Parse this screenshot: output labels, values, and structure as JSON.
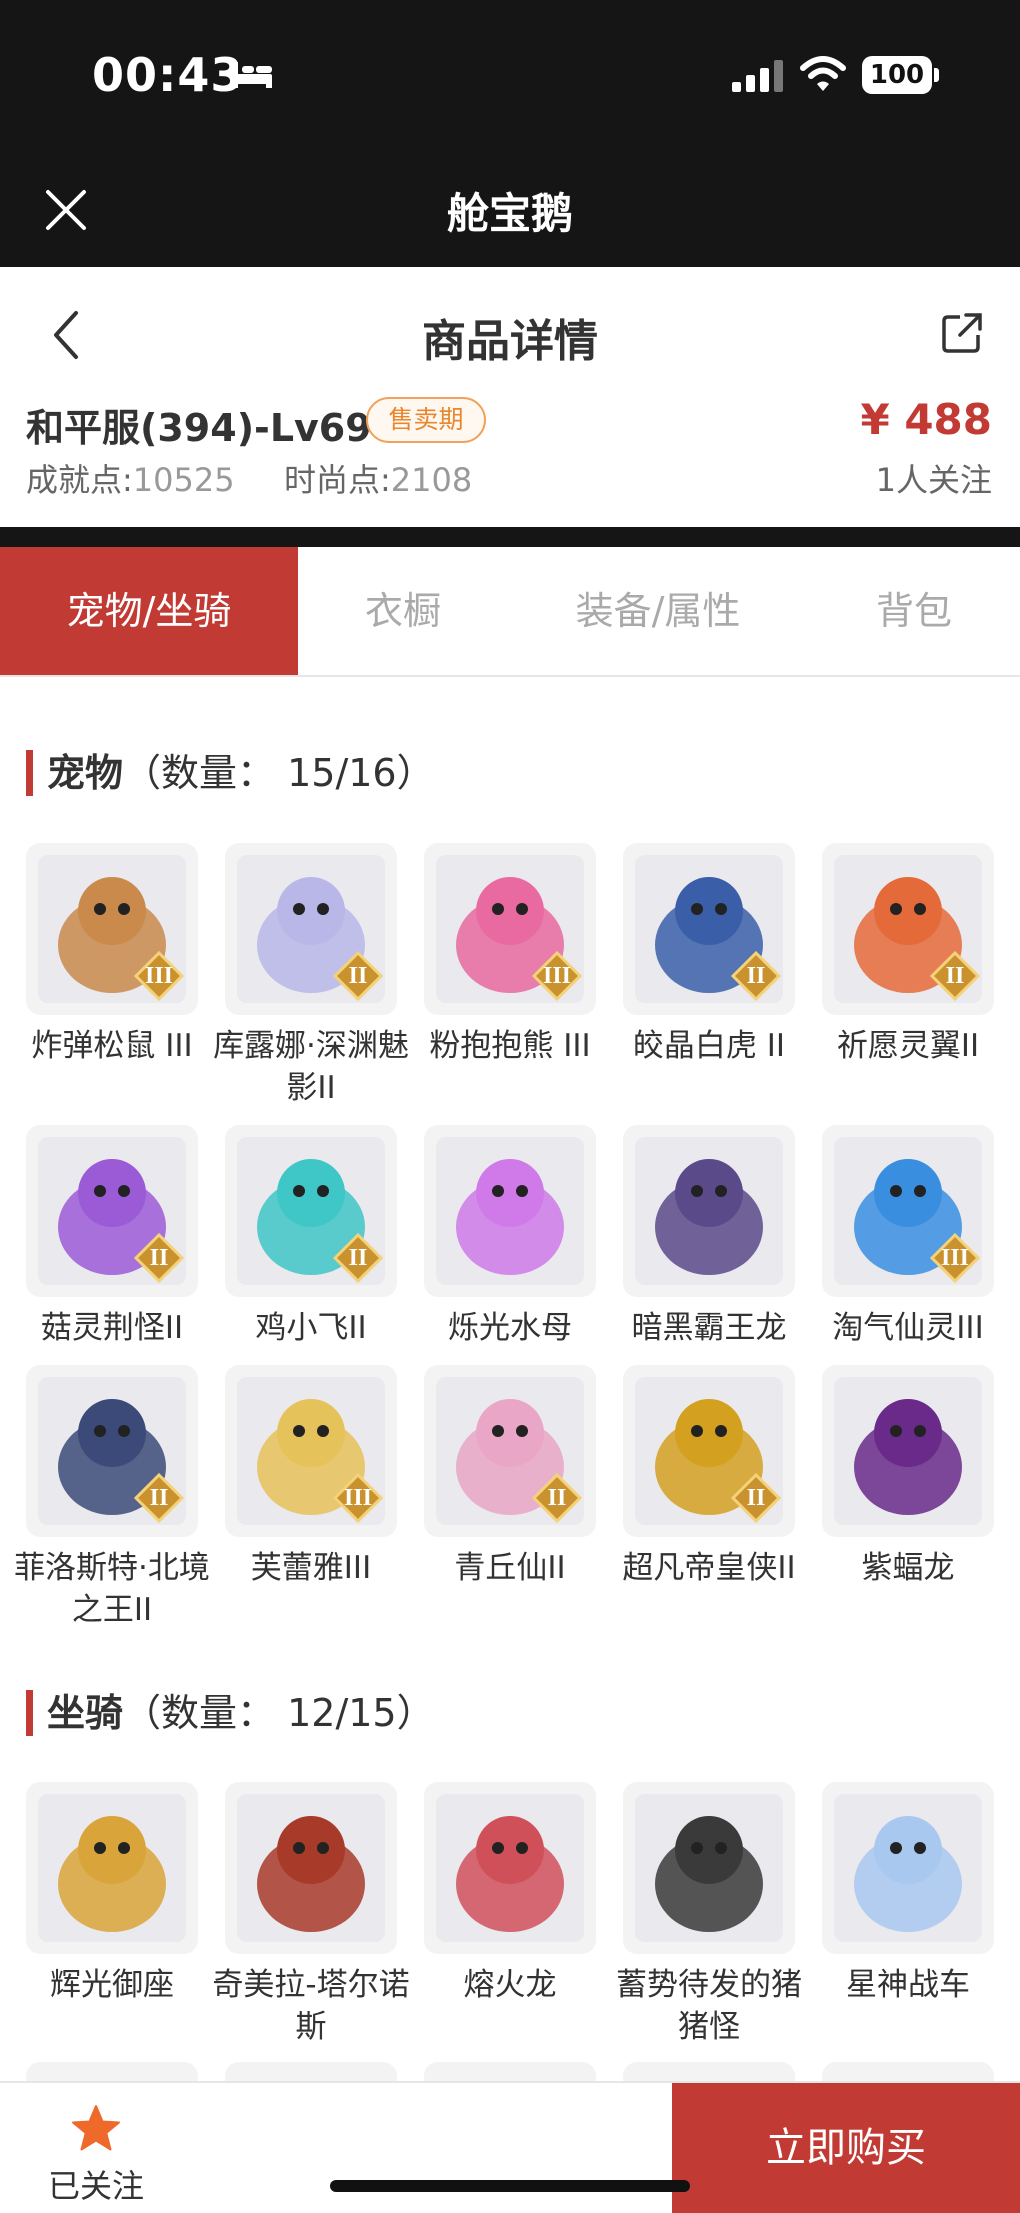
{
  "status_bar": {
    "time": "00:43",
    "battery": "100"
  },
  "app": {
    "title": "舱宝鹅"
  },
  "header": {
    "title": "商品详情"
  },
  "product": {
    "title": "和平服(394)-Lv69",
    "badge": "售卖期",
    "price": "¥ 488",
    "followers": "1人关注",
    "achievement_label": "成就点:",
    "achievement_value": "10525",
    "fashion_label": "时尚点:",
    "fashion_value": "2108"
  },
  "tabs": [
    "宠物/坐骑",
    "衣橱",
    "装备/属性",
    "背包"
  ],
  "pets": {
    "title": "宠物",
    "count": "（数量：  15/16）",
    "items": [
      {
        "name": "炸弹松鼠 III",
        "tier": "III",
        "color": "#c98a4b"
      },
      {
        "name": "库露娜·深渊魅影II",
        "tier": "II",
        "color": "#b9b7e8"
      },
      {
        "name": "粉抱抱熊 III",
        "tier": "III",
        "color": "#e86aa0"
      },
      {
        "name": "皎晶白虎 II",
        "tier": "II",
        "color": "#3a5fa8"
      },
      {
        "name": "祈愿灵翼II",
        "tier": "II",
        "color": "#e56a3a"
      },
      {
        "name": "菇灵荆怪II",
        "tier": "II",
        "color": "#9b5ad6"
      },
      {
        "name": "鸡小飞II",
        "tier": "II",
        "color": "#3fc6c6"
      },
      {
        "name": "烁光水母",
        "tier": "",
        "color": "#cf7ae8"
      },
      {
        "name": "暗黑霸王龙",
        "tier": "",
        "color": "#5a4a8a"
      },
      {
        "name": "淘气仙灵III",
        "tier": "III",
        "color": "#3a8ee0"
      },
      {
        "name": "菲洛斯特·北境之王II",
        "tier": "II",
        "color": "#3b4a78"
      },
      {
        "name": "芙蕾雅III",
        "tier": "III",
        "color": "#e6c25a"
      },
      {
        "name": "青丘仙II",
        "tier": "II",
        "color": "#e9a6c6"
      },
      {
        "name": "超凡帝皇侠II",
        "tier": "II",
        "color": "#d4a020"
      },
      {
        "name": "紫蝠龙",
        "tier": "",
        "color": "#6a2a8a"
      }
    ]
  },
  "mounts": {
    "title": "坐骑",
    "count": "（数量：  12/15）",
    "items": [
      {
        "name": "辉光御座",
        "tier": "",
        "color": "#d9a53a"
      },
      {
        "name": "奇美拉-塔尔诺斯",
        "tier": "",
        "color": "#a83a2a"
      },
      {
        "name": "熔火龙",
        "tier": "",
        "color": "#d0505a"
      },
      {
        "name": "蓄势待发的猪猪怪",
        "tier": "",
        "color": "#3a3a3a"
      },
      {
        "name": "星神战车",
        "tier": "",
        "color": "#a8c8f0"
      }
    ]
  },
  "bottom": {
    "followed": "已关注",
    "buy": "立即购买"
  },
  "colors": {
    "accent": "#c23a34",
    "badge": "#e9862e",
    "status_bg": "#151515"
  }
}
